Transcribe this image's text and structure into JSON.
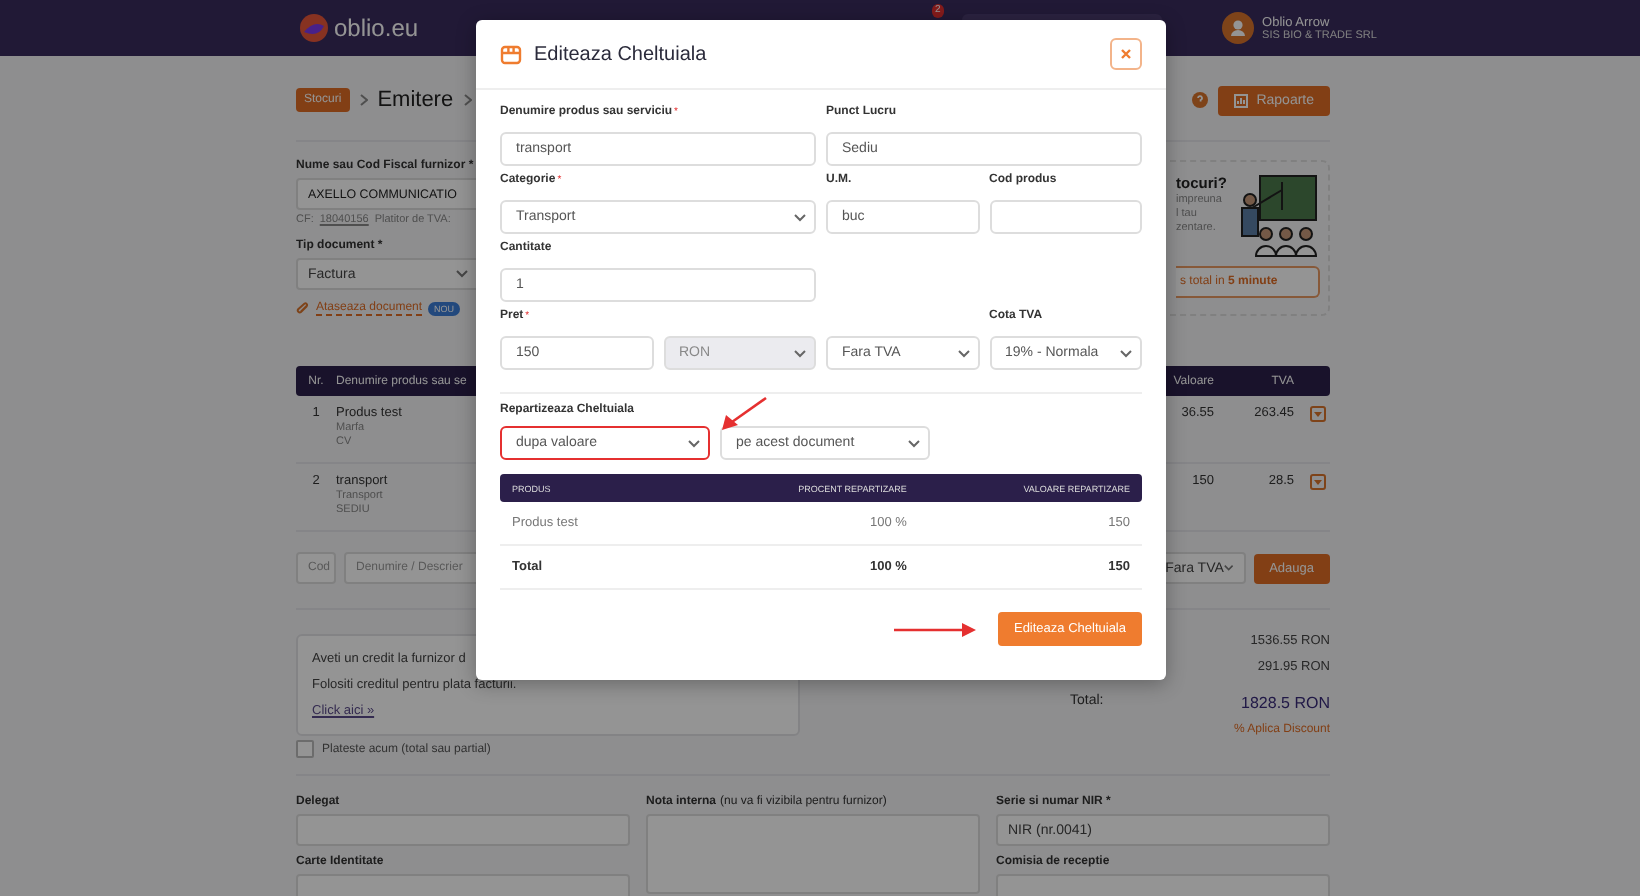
{
  "header": {
    "logo": "oblio.eu",
    "notification_count": "2",
    "user_name": "Oblio Arrow",
    "company": "SIS BIO & TRADE SRL"
  },
  "breadcrumb": {
    "badge": "Stocuri",
    "current": "Emitere",
    "reports_button": "Rapoarte"
  },
  "supplier": {
    "label": "Nume sau Cod Fiscal furnizor *",
    "value": "AXELLO COMMUNICATIO",
    "cf_label": "CF:",
    "cf": "18040156",
    "vat_note": "Platitor de TVA:"
  },
  "document_type": {
    "label": "Tip document *",
    "value": "Factura"
  },
  "attach": {
    "label": "Ataseaza document",
    "badge": "NOU"
  },
  "promo": {
    "title": "tocuri?",
    "lines": [
      "impreuna",
      "l tau",
      "zentare."
    ],
    "button": "s total in **5 minute**"
  },
  "items_table": {
    "columns_left": [
      "Nr.",
      "Denumire produs sau se"
    ],
    "columns_right": [
      "Valoare",
      "TVA"
    ],
    "rows": [
      {
        "nr": "1",
        "name": "Produs test",
        "type": "Marfa",
        "location": "CV",
        "value": "36.55",
        "vat": "263.45"
      },
      {
        "nr": "2",
        "name": "transport",
        "type": "Transport",
        "location": "SEDIU",
        "value": "150",
        "vat": "28.5"
      }
    ]
  },
  "add_row": {
    "code_placeholder": "Cod",
    "name_placeholder": "Denumire / Descrier",
    "vat_select": "Fara TVA",
    "add_button": "Adauga"
  },
  "credit": {
    "lines": [
      "Aveti un credit la furnizor d",
      "Folositi creditul pentru plata facturii."
    ],
    "link": "Click aici »"
  },
  "totals": {
    "subtotal": "1536.55 RON",
    "vat": "291.95 RON",
    "total_label": "Total:",
    "total": "1828.5 RON",
    "discount_link": "% Aplica Discount"
  },
  "pay_now": {
    "label": "Plateste acum (total sau partial)",
    "checked": false
  },
  "bottom": {
    "delegate_label": "Delegat",
    "id_card_label": "Carte Identitate",
    "note_label": "Nota interna",
    "note_hint": "(nu va fi vizibila pentru furnizor)",
    "nir_label": "Serie si numar NIR *",
    "nir_value": "NIR (nr.0041)",
    "committee_label": "Comisia de receptie"
  },
  "modal": {
    "title": "Editeaza Cheltuiala",
    "rows": [
      {
        "left": [
          {
            "label": "Denumire produs sau serviciu",
            "mark": "*",
            "kind": "text",
            "value": "transport",
            "disabled": false
          }
        ],
        "right": [
          {
            "label": "Punct Lucru",
            "kind": "text",
            "value": "Sediu",
            "disabled": false
          }
        ]
      },
      {
        "left": [
          {
            "label": "Categorie",
            "mark": "*",
            "kind": "select",
            "value": "Transport",
            "disabled": false
          }
        ],
        "right": [
          {
            "label": "U.M.",
            "kind": "text",
            "value": "buc",
            "disabled": false
          },
          {
            "label": "Cod produs",
            "kind": "text",
            "disabled": false
          }
        ]
      },
      {
        "left": [
          {
            "label": "Cantitate",
            "kind": "text",
            "value": "1",
            "disabled": false
          }
        ]
      },
      {
        "left": [
          {
            "label": "Pret",
            "mark": "*",
            "kind": "text",
            "value": "150",
            "disabled": false
          },
          {
            "kind": "select",
            "value": "RON",
            "disabled": true
          }
        ],
        "right": [
          {
            "kind": "select",
            "value": "Fara TVA",
            "disabled": false
          },
          {
            "label": "Cota TVA",
            "kind": "select",
            "value": "19% - Normala",
            "disabled": false
          }
        ]
      }
    ],
    "allocation": {
      "title": "Repartizeaza Cheltuiala",
      "selects": [
        {
          "value": "dupa valoare",
          "highlighted": true
        },
        {
          "value": "pe acest document",
          "highlighted": false
        }
      ],
      "columns": [
        "PRODUS",
        "PROCENT REPARTIZARE",
        "VALOARE REPARTIZARE"
      ],
      "rows": [
        {
          "kind": "item",
          "cells": [
            "Produs test",
            "100 %",
            "150"
          ]
        },
        {
          "kind": "total",
          "cells": [
            "Total",
            "100 %",
            "150"
          ]
        }
      ]
    },
    "submit_button": "Editeaza Cheltuiala"
  }
}
